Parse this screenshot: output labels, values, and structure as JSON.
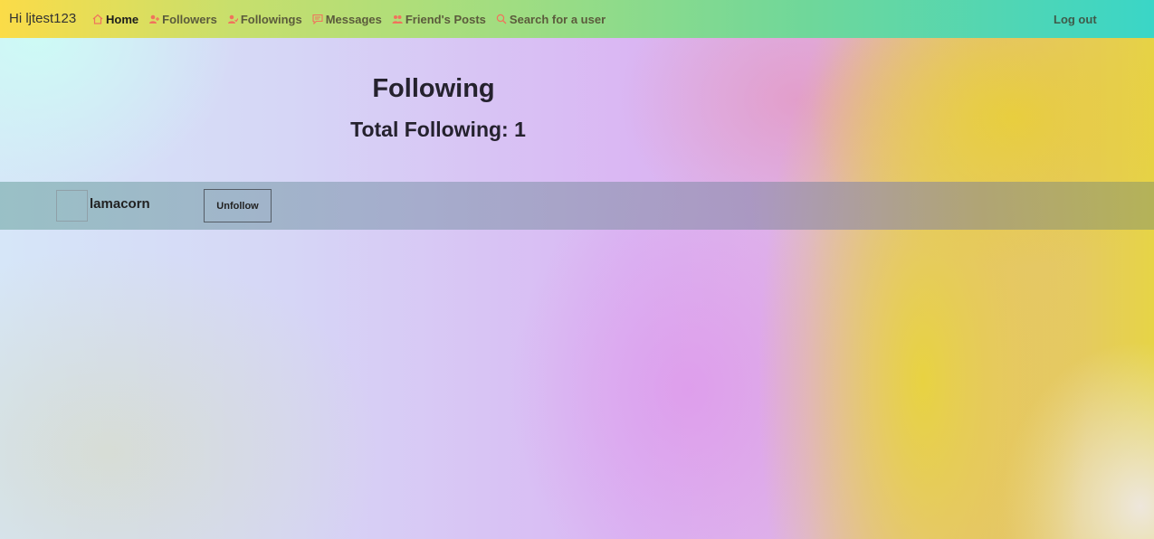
{
  "navbar": {
    "greeting": "Hi ljtest123",
    "links": [
      {
        "label": "Home",
        "icon": "home-icon"
      },
      {
        "label": "Followers",
        "icon": "user-add-icon"
      },
      {
        "label": "Followings",
        "icon": "user-follow-icon"
      },
      {
        "label": "Messages",
        "icon": "message-icon"
      },
      {
        "label": "Friend's Posts",
        "icon": "friends-icon"
      },
      {
        "label": "Search for a user",
        "icon": "search-icon"
      }
    ],
    "logout_label": "Log out",
    "icon_color": "#f0735c"
  },
  "main": {
    "title": "Following",
    "total_label": "Total Following: 1"
  },
  "followings": [
    {
      "username": "lamacorn",
      "button_label": "Unfollow"
    }
  ]
}
